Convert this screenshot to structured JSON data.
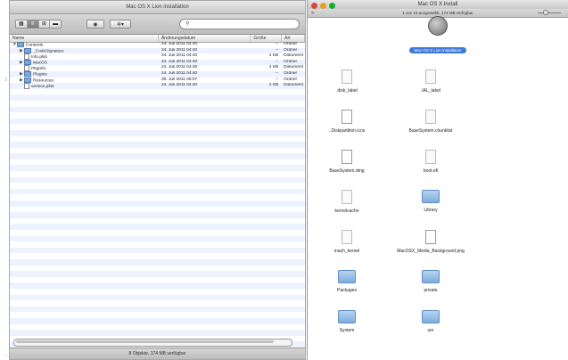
{
  "left_window": {
    "title": "Mac OS X Lion installation",
    "search_placeholder": "",
    "columns": [
      "Name",
      "Änderungsdatum",
      "Größe",
      "Art"
    ],
    "rows": [
      {
        "depth": 0,
        "expand": "▼",
        "icon": "folder",
        "name": "Contents",
        "date": "24. Juli 2011 04:40",
        "size": "--",
        "kind": "Ordner"
      },
      {
        "depth": 1,
        "expand": "▶",
        "icon": "folder",
        "name": "_CodeSignature",
        "date": "24. Juli 2011 04:40",
        "size": "--",
        "kind": "Ordner"
      },
      {
        "depth": 1,
        "expand": "",
        "icon": "doc",
        "name": "Info.plist",
        "date": "24. Juli 2011 04:40",
        "size": "4 KB",
        "kind": "Dokument"
      },
      {
        "depth": 1,
        "expand": "▶",
        "icon": "folder",
        "name": "MacOS",
        "date": "24. Juli 2011 04:40",
        "size": "--",
        "kind": "Ordner"
      },
      {
        "depth": 1,
        "expand": "",
        "icon": "doc",
        "name": "PkgInfo",
        "date": "24. Juli 2011 04:40",
        "size": "4 KB",
        "kind": "Dokument"
      },
      {
        "depth": 1,
        "expand": "▶",
        "icon": "folder",
        "name": "Plugins",
        "date": "24. Juli 2011 04:40",
        "size": "--",
        "kind": "Ordner"
      },
      {
        "depth": 1,
        "expand": "▶",
        "icon": "folder",
        "name": "Resources",
        "date": "30. Juli 2011 05:07",
        "size": "--",
        "kind": "Ordner"
      },
      {
        "depth": 1,
        "expand": "",
        "icon": "doc",
        "name": "version.plist",
        "date": "24. Juli 2011 04:40",
        "size": "4 KB",
        "kind": "Dokument"
      }
    ],
    "status": "8 Objekte, 174 MB verfügbar"
  },
  "right_window": {
    "title": "Mac OS X Install",
    "info": "1 von 15 ausgewählt, 174 MB verfügbar",
    "selected_item": "Mac OS X Lion Installation",
    "items": [
      {
        "name": ".disk_label",
        "icon": "file"
      },
      {
        "name": ".IAL_label",
        "icon": "file"
      },
      {
        "name": "..Diskpartition.icns",
        "icon": "doc"
      },
      {
        "name": "BaseSystem.chunklist",
        "icon": "file"
      },
      {
        "name": "BaseSystem.dmg",
        "icon": "doc"
      },
      {
        "name": "boot.efi",
        "icon": "file"
      },
      {
        "name": "kernelcache",
        "icon": "file"
      },
      {
        "name": "Library",
        "icon": "folder"
      },
      {
        "name": "mach_kernel",
        "icon": "file"
      },
      {
        "name": "MacOSX_Media_Background.png",
        "icon": "doc"
      },
      {
        "name": "Packages",
        "icon": "folder"
      },
      {
        "name": "private",
        "icon": "folder"
      },
      {
        "name": "System",
        "icon": "folder"
      },
      {
        "name": "usr",
        "icon": "folder"
      }
    ]
  },
  "colors": {
    "selection": "#3f7ad8",
    "stripe": "#edf3fe",
    "close": "#e0443e",
    "minimize": "#dea123",
    "zoom": "#1aab29"
  }
}
